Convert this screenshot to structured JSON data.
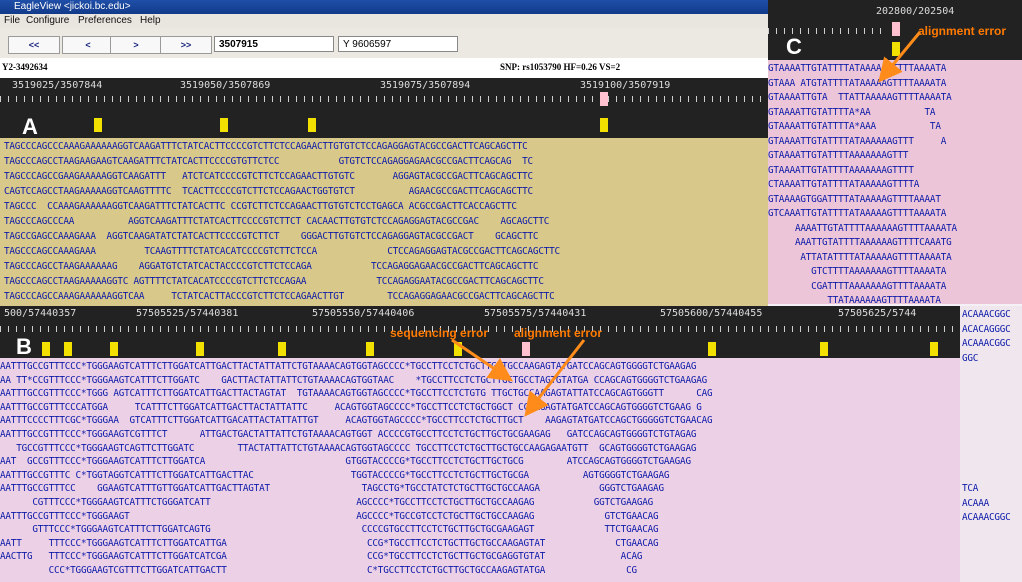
{
  "window": {
    "title": "EagleView <jickoi.bc.edu>"
  },
  "menu": [
    "File",
    "Configure",
    "Preferences",
    "Help"
  ],
  "toolbar": {
    "buttons": [
      "<<",
      "<",
      ">",
      ">>"
    ],
    "position_value": "3507915",
    "y_value": "Y 9606597"
  },
  "status": {
    "left": "Y2-3492634",
    "right": "SNP: rs1053790 HF=0.26 VS=2"
  },
  "panel_a": {
    "letter": "A",
    "ruler_labels": [
      "3519025/3507844",
      "3519050/3507869",
      "3519075/3507894",
      "3519100/3507919"
    ],
    "reads": [
      "TAGCCCAGCCCAAAGAAAAAAGGTCAAGATTTCTATCACTTCCCCGTCTTCTCCAGAACTTGTGTCTCCAGAGGAGTACGCCGACTTCAGCAGCTTC",
      "TAGCCCAGCCTAAGAAGAAGTCAAGATTTCTATCACTTCCCCGTGTTCTCC           GTGTCTCCAGAGGAGAACGCCGACTTCAGCAG  TC",
      "TAGCCCAGCCGAAGAAAAAGGTCAAGATTT   ATCTCATCCCCGTCTTCTCCAGAACTTGTGTC       AGGAGTACGCCGACTTCAGCAGCTTC",
      "CAGTCCAGCCTAAGAAAAAGGTCAAGTTTTC  TCACTTCCCCGTCTTCTCCAGAACTGGTGTCT          AGAACGCCGACTTCAGCAGCTTC",
      "TAGCCC  CCAAAGAAAAAAGGTCAAGATTTCTATCACTTC CCGTCTTCTCCAGAACTTGTGTCTCCTGAGCA ACGCCGACTTCACCAGCTTC",
      "TAGCCCAGCCCAA          AGGTCAAGATTTCTATCACTTCCCCGTCTTCT CACAACTTGTGTCTCCAGAGGAGTACGCCGAC    AGCAGCTTC",
      "TAGCCGAGCCAAAGAAA  AGGTCAAGATATCTATCACTTCCCCGTCTTCT    GGGACTTGTGTCTCCAGAGGAGTACGCCGACT    GCAGCTTC",
      "TAGCCCAGCCAAAGAAA         TCAAGTTTTCTATCACATCCCCGTCTTCTCCA             CTCCAGAGGAGTACGCCGACTTCAGCAGCTTC",
      "TAGCCCAGCCTAAGAAAAAAG    AGGATGTCTATCACTACCCCGTCTTCTCCAGA           TCCAGAGGAGAACGCCGACTTCAGCAGCTTC",
      "TAGCCCAGCCTAAGAAAAAGGTC AGTTTTCTATCACATCCCCGTCTTCTCCAGAA             TCCAGAGGAATACGCCGACTTCAGCAGCTTC",
      "TAGCCCAGCCAAAGAAAAAAGGTCAA     TCTATCACTTACCCGTCTTCTCCAGAACTTGT        TCCAGAGGAGAACGCCGACTTCAGCAGCTTC"
    ]
  },
  "panel_b": {
    "letter": "B",
    "ruler_labels": [
      "500/57440357",
      "57505525/57440381",
      "57505550/57440406",
      "57505575/57440431",
      "57505600/57440455",
      "57505625/5744"
    ],
    "annotations": [
      "sequencing error",
      "alignment error"
    ],
    "reads": [
      "AATTTGCCGTTTCCC*TGGGAAGTCATTTCTTGGATCATTGACTTACTATTATTCTGTAAAACAGTGGTAGCCCC*TGCCTTCCTCTGCTTGCTGCCAAGAGTATGATCCAGCAGTGGGGTCTGAAGAG",
      "AA TT*CCGTTTCCC*TGGGAAGTCATTTCTTGGATC    GACTTACTATTATTCTGTAAAACAGTGGTAAC    *TGCCTTCCTCTGCTTGCTGCCTAGTGTATGA CCAGCAGTGGGGTCTGAAGAG",
      "AATTTGCCGTTTCCC*TGGG AGTCATTTCTTGGATCATTGACTTACTAGTAT  TGTAAAACAGTGGTAGCCCC*TGCCTTCCTCTGTG TTGCTGCCAAGAGTATTATCCAGCAGTGGGTT      CAG",
      "AATTTGCCGTTTCCCATGGA     TCATTTCTTGGATCATTGACTTACTATTATTC     ACAGTGGTAGCCCC*TGCCTTCCTCTGCTGGCT CCAAGAGTATGATCCAGCAGTGGGGTCTGAAG G",
      "AATTTCCCCTTTCGC*TGGGAA  GTCATTTCTTGGATCATTGACATTACTATTATTGT     ACAGTGGTAGCCCC*TGCCTTCCTCTGCTTGCT    AAGAGTATGATCCAGCTGGGGGTCTGAACAG",
      "AATTTGCCGTTTCCC*TGGGAAGTCGTTTCT      ATTGACTGACTATTATTCTGTAAAACAGTGGT ACCCCGTGCCTTCCTCTGCTTGCTGCGAAGAG   GATCCAGCAGTGGGGTCTGTAGAG",
      "   TGCCGTTTCCC*TGGGAAGTCAGTTCTTGGATC        TTACTATTATTCTGTAAAACAGTGGTAGCCCC TGCCTTCCTCTGCTTGCTGCCAAGAGAATGTT  GCAGTGGGGTCTGAAGAG",
      "AAT  GCCGTTTCCC*TGGGAAGTCATTTCTTGGATCA                          GTGGTACCCCG*TGCCTTCCTCTGCTTGCTGCG        ATCCAGCAGTGGGGTCTGAAGAG",
      "AATTTGCCGTTTC C*TGGTAGGTCATTTCTTGGATCATTGACTTAC                  TGGTACCCCG*TGCCTTCCTCTGCTTGCTGCGA          AGTGGGGTCTGAAGAG",
      "AATTTGCCGTTTCC    GGAAGTCATTTGTTGGATCATTGACTTAGTAT                 TAGCCTG*TGCCTATCTCTGCTTGCTGCCAAGA           GGGTCTGAAGAG",
      "      CGTTTCCC*TGGGAAGTCATTTCTGGGATCATT                           AGCCCC*TGCCTTCCTCTGCTTGCTGCCAAGAG           GGTCTGAAGAG",
      "AATTTGCCGTTTCCC*TGGGAAGT                                          AGCCCC*TGCCGTCCTCTGCTTGCTGCCAAGAG             GTCTGAACAG",
      "      GTTTCCC*TGGGAAGTCATTTCTTGGATCAGTG                            CCCCGTGCCTTCCTCTGCTTGCTGCGAAGAGT             TTCTGAACAG",
      "AATT     TTTCCC*TGGGAAGTCATTTCTTGGATCATTGA                          CCG*TGCCTTCCTCTGCTTGCTGCCAAGAGTAT             CTGAACAG",
      "AACTTG   TTTCCC*TGGGAAGTCATTTCTTGGATCATCGA                          CCG*TGCCTTCCTCTGCTTGCTGCGAGGTGTAT              ACAG",
      "         CCC*TGGGAAGTCGTTTCTTGGATCATTGACTT                          C*TGCCTTCCTCTGCTTGCTGCCAAGAGTATGA               CG"
    ]
  },
  "panel_c": {
    "letter": "C",
    "ruler_label": "202800/202504",
    "annotation": "alignment error",
    "reads": [
      "GTAAAATTGTATTTTATAAAAAGTTTTAAAATA",
      "GTAAA ATGTATTTTATAAAAAGTTTTAAAATA",
      "GTAAAATTGTA  TTATTAAAAAGTTTTAAAATA",
      "GTAAAATTGTATTTTA*AA          TA",
      "GTAAAATTGTATTTTA*AAA          TA",
      "GTAAAATTGTATTTTATAAAAAAGTTT     A",
      "GTAAAATTGTATTTTAAAAAAAGTTT",
      "GTAAAATTGTATTTTAAAAAAAGTTTT",
      "CTAAAATTGTATTTTATAAAAAGTTTTA",
      "GTAAAAGTGGATTTTATAAAAAGTTTTAAAAT",
      "GTCAAATTGTATTTTATAAAAAGTTTTAAAATA",
      "     AAAATTGTATTTTAAAAAAGTTTTAAAATA",
      "     AAATTGTATTTTAAAAAAGTTTTCAAATG",
      "      ATTATATTTTATAAAAAGTTTTAAAATA",
      "        GTCTTTTAAAAAAAGTTTTAAAATA",
      "        CGATTTTAAAAAAAGTTTTAAAATA",
      "           TTATAAAAAAGTTTTAAAATA"
    ]
  },
  "panel_right": {
    "reads": [
      "ACAAACGGC",
      "ACACAGGGC",
      "ACAAACGGC",
      "GGC",
      "",
      "",
      "",
      "",
      "",
      "",
      "",
      "",
      "TCA",
      "ACAAA",
      "ACAAACGGC"
    ]
  }
}
